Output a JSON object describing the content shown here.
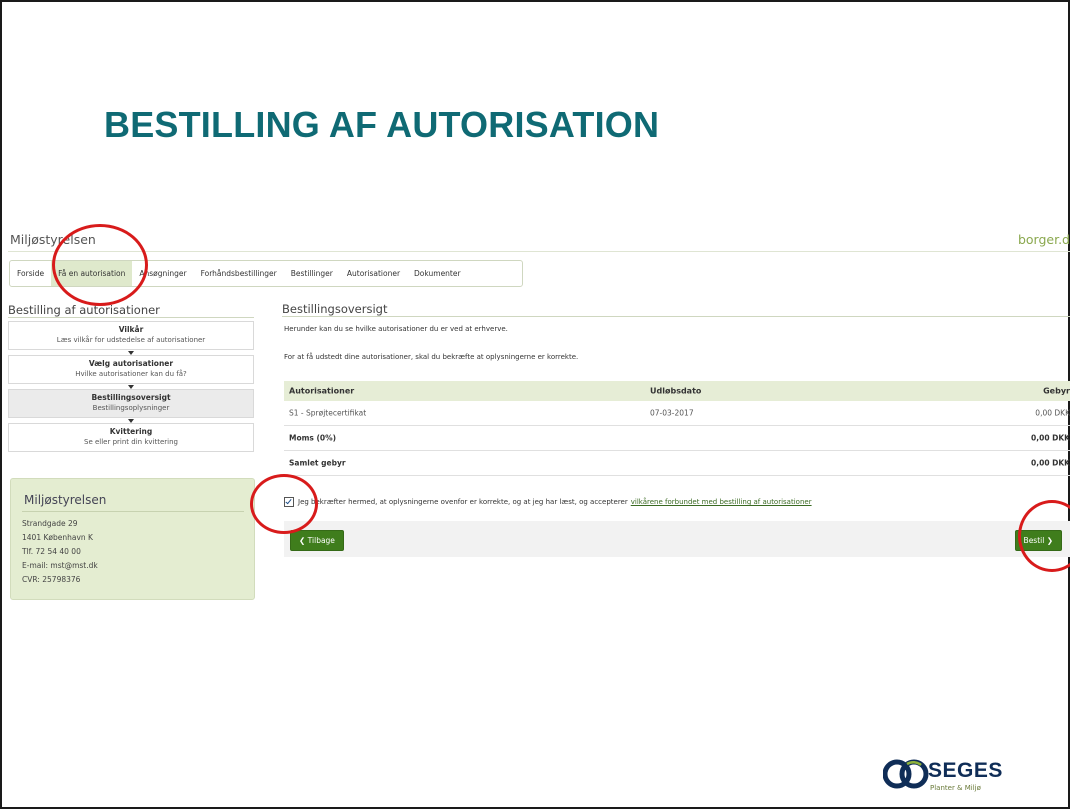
{
  "slide": {
    "title": "BESTILLING AF AUTORISATION"
  },
  "site": {
    "name": "Miljøstyrelsen",
    "portal": "borger.d"
  },
  "nav": {
    "items": [
      "Forside",
      "Få en autorisation",
      "Ansøgninger",
      "Forhåndsbestillinger",
      "Bestillinger",
      "Autorisationer",
      "Dokumenter"
    ],
    "active_index": 1
  },
  "sidebar": {
    "title": "Bestilling af autorisationer",
    "steps": [
      {
        "title": "Vilkår",
        "subtitle": "Læs vilkår for udstedelse af autorisationer"
      },
      {
        "title": "Vælg autorisationer",
        "subtitle": "Hvilke autorisationer kan du få?"
      },
      {
        "title": "Bestillingsoversigt",
        "subtitle": "Bestillingsoplysninger"
      },
      {
        "title": "Kvittering",
        "subtitle": "Se eller print din kvittering"
      }
    ],
    "active_step": 2
  },
  "address": {
    "title": "Miljøstyrelsen",
    "lines": [
      "Strandgade 29",
      "1401 København K",
      "Tlf. 72 54 40 00",
      "E-mail: mst@mst.dk",
      "CVR: 25798376"
    ]
  },
  "main": {
    "title": "Bestillingsoversigt",
    "intro1": "Herunder kan du se hvilke autorisationer du er ved at erhverve.",
    "intro2": "For at få udstedt dine autorisationer, skal du bekræfte at oplysningerne er korrekte.",
    "table": {
      "headers": [
        "Autorisationer",
        "Udløbsdato",
        "Gebyr"
      ],
      "rows": [
        [
          "S1 - Sprøjtecertifikat",
          "07-03-2017",
          "0,00 DKK"
        ]
      ],
      "vat_label": "Moms (0%)",
      "vat_value": "0,00 DKK",
      "total_label": "Samlet gebyr",
      "total_value": "0,00 DKK"
    },
    "consent_text": "Jeg bekræfter hermed, at oplysningerne ovenfor er korrekte, og at jeg har læst, og accepterer",
    "consent_link": "vilkårene forbundet med bestilling af autorisationer",
    "consent_checked": true,
    "back_label": "Tilbage",
    "order_label": "Bestil"
  },
  "logo": {
    "name": "SEGES",
    "sub": "Planter & Miljø"
  },
  "colors": {
    "title": "#0f6a74",
    "accent_green": "#3f7d1c",
    "highlight_ring": "#d81b1b"
  }
}
